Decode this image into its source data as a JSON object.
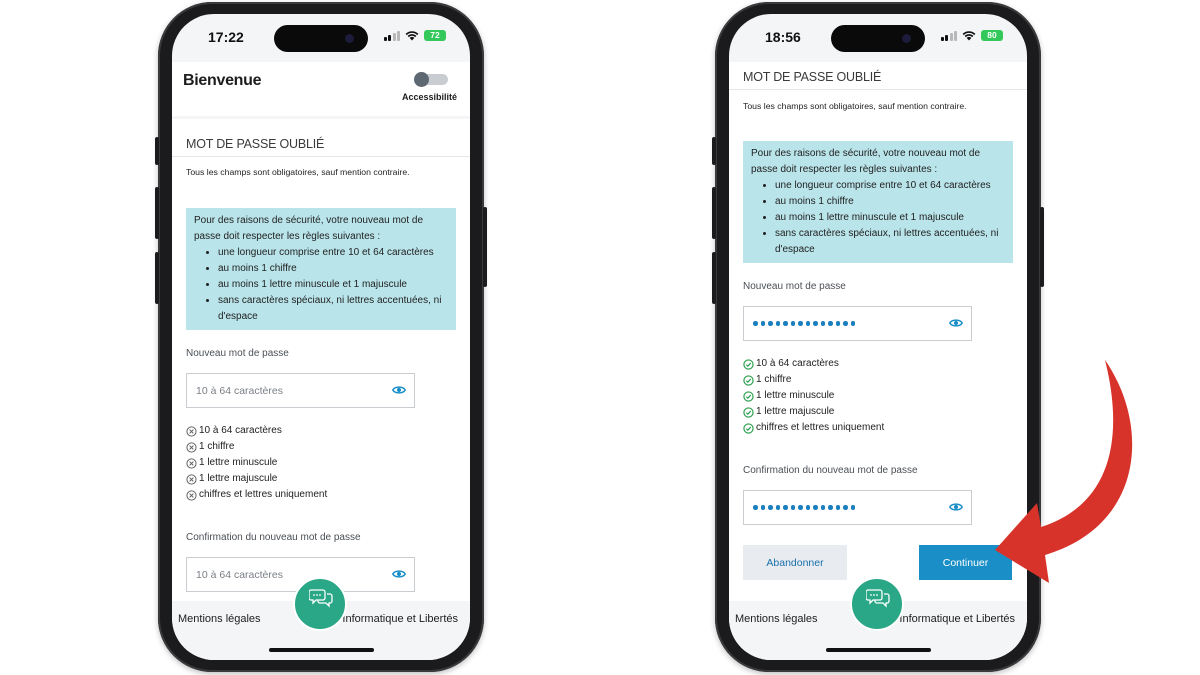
{
  "colors": {
    "accent": "#1a8fc7",
    "info_box": "#b9e4ea",
    "valid": "#2a9d4c",
    "invalid": "#666666",
    "fab": "#2aa787",
    "arrow": "#d8332a",
    "battery": "#34c759"
  },
  "left": {
    "status": {
      "time": "17:22",
      "battery": "72"
    },
    "header": {
      "title": "Bienvenue",
      "toggle_label": "Accessibilité",
      "toggle_on": false
    },
    "section_title": "MOT DE PASSE OUBLIÉ",
    "required_note": "Tous les champs sont obligatoires, sauf mention contraire.",
    "rules": {
      "intro": "Pour des raisons de sécurité, votre nouveau mot de passe doit respecter les règles suivantes :",
      "items": [
        "une longueur comprise entre 10 et 64 caractères",
        "au moins 1 chiffre",
        "au moins 1 lettre minuscule et 1 majuscule",
        "sans caractères spéciaux, ni lettres accentuées, ni d'espace"
      ]
    },
    "new_password": {
      "label": "Nouveau mot de passe",
      "placeholder": "10 à 64 caractères"
    },
    "checks": [
      {
        "text": "10 à 64 caractères",
        "status": "invalid"
      },
      {
        "text": "1 chiffre",
        "status": "invalid"
      },
      {
        "text": "1 lettre minuscule",
        "status": "invalid"
      },
      {
        "text": "1 lettre majuscule",
        "status": "invalid"
      },
      {
        "text": "chiffres et lettres uniquement",
        "status": "invalid"
      }
    ],
    "confirm_password": {
      "label": "Confirmation du nouveau mot de passe",
      "placeholder": "10 à 64 caractères"
    },
    "footer": {
      "legal": "Mentions légales",
      "privacy": "Informatique et Libertés"
    },
    "fab_icon": "chat-bubbles-icon"
  },
  "right": {
    "status": {
      "time": "18:56",
      "battery": "80"
    },
    "section_title": "MOT DE PASSE OUBLIÉ",
    "required_note": "Tous les champs sont obligatoires, sauf mention contraire.",
    "rules": {
      "intro": "Pour des raisons de sécurité, votre nouveau mot de passe doit respecter les règles suivantes :",
      "items": [
        "une longueur comprise entre 10 et 64 caractères",
        "au moins 1 chiffre",
        "au moins 1 lettre minuscule et 1 majuscule",
        "sans caractères spéciaux, ni lettres accentuées, ni d'espace"
      ]
    },
    "new_password": {
      "label": "Nouveau mot de passe",
      "masked_length": 14
    },
    "checks": [
      {
        "text": "10 à 64 caractères",
        "status": "valid"
      },
      {
        "text": "1 chiffre",
        "status": "valid"
      },
      {
        "text": "1 lettre minuscule",
        "status": "valid"
      },
      {
        "text": "1 lettre majuscule",
        "status": "valid"
      },
      {
        "text": "chiffres et lettres uniquement",
        "status": "valid"
      }
    ],
    "confirm_password": {
      "label": "Confirmation du nouveau mot de passe",
      "masked_length": 14
    },
    "buttons": {
      "abandon": "Abandonner",
      "continue": "Continuer"
    },
    "footer": {
      "legal": "Mentions légales",
      "privacy": "Informatique et Libertés"
    },
    "fab_icon": "chat-bubbles-icon"
  }
}
